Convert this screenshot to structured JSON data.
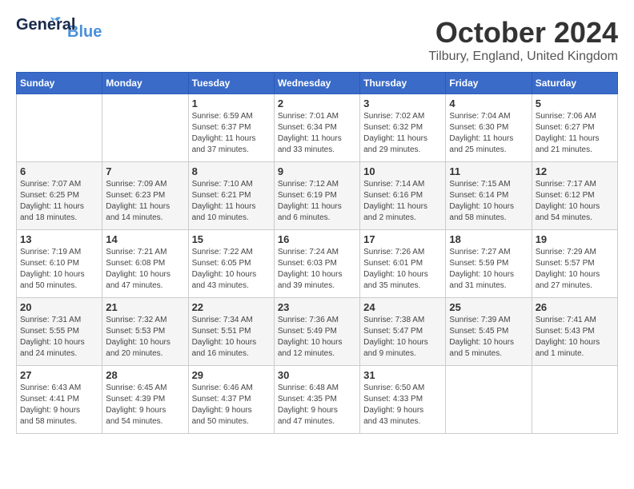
{
  "logo": {
    "general": "General",
    "blue": "Blue"
  },
  "header": {
    "month_year": "October 2024",
    "location": "Tilbury, England, United Kingdom"
  },
  "weekdays": [
    "Sunday",
    "Monday",
    "Tuesday",
    "Wednesday",
    "Thursday",
    "Friday",
    "Saturday"
  ],
  "weeks": [
    [
      {
        "day": "",
        "info": ""
      },
      {
        "day": "",
        "info": ""
      },
      {
        "day": "1",
        "info": "Sunrise: 6:59 AM\nSunset: 6:37 PM\nDaylight: 11 hours\nand 37 minutes."
      },
      {
        "day": "2",
        "info": "Sunrise: 7:01 AM\nSunset: 6:34 PM\nDaylight: 11 hours\nand 33 minutes."
      },
      {
        "day": "3",
        "info": "Sunrise: 7:02 AM\nSunset: 6:32 PM\nDaylight: 11 hours\nand 29 minutes."
      },
      {
        "day": "4",
        "info": "Sunrise: 7:04 AM\nSunset: 6:30 PM\nDaylight: 11 hours\nand 25 minutes."
      },
      {
        "day": "5",
        "info": "Sunrise: 7:06 AM\nSunset: 6:27 PM\nDaylight: 11 hours\nand 21 minutes."
      }
    ],
    [
      {
        "day": "6",
        "info": "Sunrise: 7:07 AM\nSunset: 6:25 PM\nDaylight: 11 hours\nand 18 minutes."
      },
      {
        "day": "7",
        "info": "Sunrise: 7:09 AM\nSunset: 6:23 PM\nDaylight: 11 hours\nand 14 minutes."
      },
      {
        "day": "8",
        "info": "Sunrise: 7:10 AM\nSunset: 6:21 PM\nDaylight: 11 hours\nand 10 minutes."
      },
      {
        "day": "9",
        "info": "Sunrise: 7:12 AM\nSunset: 6:19 PM\nDaylight: 11 hours\nand 6 minutes."
      },
      {
        "day": "10",
        "info": "Sunrise: 7:14 AM\nSunset: 6:16 PM\nDaylight: 11 hours\nand 2 minutes."
      },
      {
        "day": "11",
        "info": "Sunrise: 7:15 AM\nSunset: 6:14 PM\nDaylight: 10 hours\nand 58 minutes."
      },
      {
        "day": "12",
        "info": "Sunrise: 7:17 AM\nSunset: 6:12 PM\nDaylight: 10 hours\nand 54 minutes."
      }
    ],
    [
      {
        "day": "13",
        "info": "Sunrise: 7:19 AM\nSunset: 6:10 PM\nDaylight: 10 hours\nand 50 minutes."
      },
      {
        "day": "14",
        "info": "Sunrise: 7:21 AM\nSunset: 6:08 PM\nDaylight: 10 hours\nand 47 minutes."
      },
      {
        "day": "15",
        "info": "Sunrise: 7:22 AM\nSunset: 6:05 PM\nDaylight: 10 hours\nand 43 minutes."
      },
      {
        "day": "16",
        "info": "Sunrise: 7:24 AM\nSunset: 6:03 PM\nDaylight: 10 hours\nand 39 minutes."
      },
      {
        "day": "17",
        "info": "Sunrise: 7:26 AM\nSunset: 6:01 PM\nDaylight: 10 hours\nand 35 minutes."
      },
      {
        "day": "18",
        "info": "Sunrise: 7:27 AM\nSunset: 5:59 PM\nDaylight: 10 hours\nand 31 minutes."
      },
      {
        "day": "19",
        "info": "Sunrise: 7:29 AM\nSunset: 5:57 PM\nDaylight: 10 hours\nand 27 minutes."
      }
    ],
    [
      {
        "day": "20",
        "info": "Sunrise: 7:31 AM\nSunset: 5:55 PM\nDaylight: 10 hours\nand 24 minutes."
      },
      {
        "day": "21",
        "info": "Sunrise: 7:32 AM\nSunset: 5:53 PM\nDaylight: 10 hours\nand 20 minutes."
      },
      {
        "day": "22",
        "info": "Sunrise: 7:34 AM\nSunset: 5:51 PM\nDaylight: 10 hours\nand 16 minutes."
      },
      {
        "day": "23",
        "info": "Sunrise: 7:36 AM\nSunset: 5:49 PM\nDaylight: 10 hours\nand 12 minutes."
      },
      {
        "day": "24",
        "info": "Sunrise: 7:38 AM\nSunset: 5:47 PM\nDaylight: 10 hours\nand 9 minutes."
      },
      {
        "day": "25",
        "info": "Sunrise: 7:39 AM\nSunset: 5:45 PM\nDaylight: 10 hours\nand 5 minutes."
      },
      {
        "day": "26",
        "info": "Sunrise: 7:41 AM\nSunset: 5:43 PM\nDaylight: 10 hours\nand 1 minute."
      }
    ],
    [
      {
        "day": "27",
        "info": "Sunrise: 6:43 AM\nSunset: 4:41 PM\nDaylight: 9 hours\nand 58 minutes."
      },
      {
        "day": "28",
        "info": "Sunrise: 6:45 AM\nSunset: 4:39 PM\nDaylight: 9 hours\nand 54 minutes."
      },
      {
        "day": "29",
        "info": "Sunrise: 6:46 AM\nSunset: 4:37 PM\nDaylight: 9 hours\nand 50 minutes."
      },
      {
        "day": "30",
        "info": "Sunrise: 6:48 AM\nSunset: 4:35 PM\nDaylight: 9 hours\nand 47 minutes."
      },
      {
        "day": "31",
        "info": "Sunrise: 6:50 AM\nSunset: 4:33 PM\nDaylight: 9 hours\nand 43 minutes."
      },
      {
        "day": "",
        "info": ""
      },
      {
        "day": "",
        "info": ""
      }
    ]
  ]
}
